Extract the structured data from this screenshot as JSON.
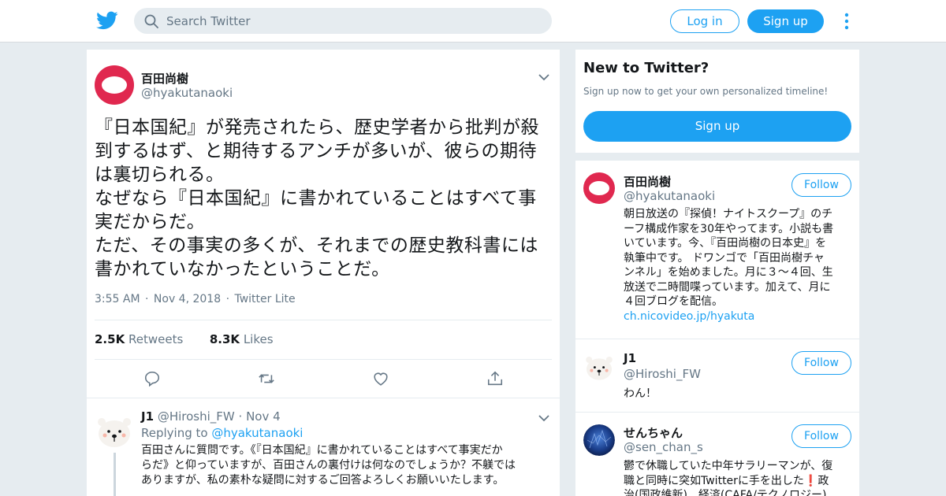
{
  "topbar": {
    "logo_icon": "twitter-bird-icon",
    "search_placeholder": "Search Twitter",
    "login_label": "Log in",
    "signup_label": "Sign up",
    "more_icon": "vertical-dots-icon",
    "accent_color": "#1da1f2"
  },
  "tweet": {
    "name": "百田尚樹",
    "handle": "@hyakutanaoki",
    "text_lines": [
      "『日本国紀』が発売されたら、歴史学者から批判が殺",
      "到するはず、と期待するアンチが多いが、彼らの期待",
      "は裏切られる。",
      "なぜなら『日本国紀』に書かれていることはすべて事",
      "実だからだ。",
      "ただ、その事実の多くが、それまでの歴史教科書には",
      "書かれていなかったということだ。"
    ],
    "time": "3:55 AM",
    "date": "Nov 4, 2018",
    "source": "Twitter Lite",
    "dot": "·",
    "retweets_count": "2.5K",
    "retweets_label": "Retweets",
    "likes_count": "8.3K",
    "likes_label": "Likes",
    "actions": [
      "reply-icon",
      "retweet-icon",
      "like-icon",
      "share-icon"
    ]
  },
  "reply": {
    "name": "J1",
    "handle": "@Hiroshi_FW",
    "dot": "·",
    "date": "Nov 4",
    "replying_to_label": "Replying to",
    "replying_to_handle": "@hyakutanaoki",
    "text_lines": [
      "百田さんに質問です。《『日本国紀』に書かれていることはすべて事実だか",
      "らだ》と仰っていますが、百田さんの裏付けは何なのでしょうか？不躾では",
      "ありますが、私の素朴な疑問に対するご回答よろしくお願いいたします。"
    ]
  },
  "signup_box": {
    "title": "New to Twitter?",
    "subtitle": "Sign up now to get your own personalized timeline!",
    "button": "Sign up"
  },
  "users": [
    {
      "name": "百田尚樹",
      "handle": "@hyakutanaoki",
      "follow": "Follow",
      "bio_lines": [
        "朝日放送の『探偵！ナイトスクープ』のチ",
        "ーフ構成作家を30年やってます。小説も書",
        "いています。今、『百田尚樹の日本史』を",
        "執筆中です。 ドワンゴで「百田尚樹チャ",
        "ンネル」を始めました。月に３～４回、生",
        "放送で二時間喋っています。加えて、月に",
        "４回ブログを配信。"
      ],
      "link": "ch.nicovideo.jp/hyakuta"
    },
    {
      "name": "J1",
      "handle": "@Hiroshi_FW",
      "follow": "Follow",
      "bio_lines": [
        "わん！"
      ]
    },
    {
      "name": "せんちゃん",
      "handle": "@sen_chan_s",
      "follow": "Follow",
      "bio_lines": [
        "鬱で休職していた中年サラリーマンが、復",
        "職と同時に突如Twitterに手を出した❗政",
        "治(国政維新)、経済(CAFA/テクノロジー)"
      ]
    }
  ]
}
